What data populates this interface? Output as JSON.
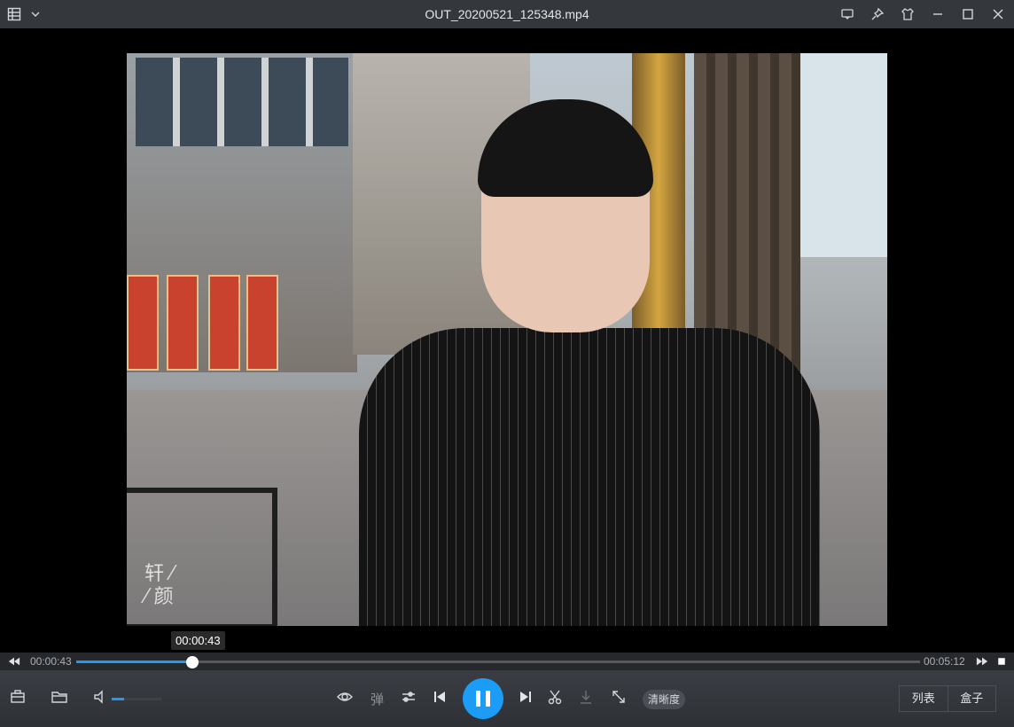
{
  "window": {
    "title": "OUT_20200521_125348.mp4",
    "left_icons": [
      "playlist-icon",
      "chevron-down-icon"
    ],
    "right_icons": [
      "message-icon",
      "pin-icon",
      "skin-icon",
      "minimize-icon",
      "maximize-icon",
      "close-icon"
    ]
  },
  "video": {
    "watermark_line1": "轩 ⁄",
    "watermark_line2": "⁄ 颜"
  },
  "playback": {
    "tooltip_time": "00:00:43",
    "current_time": "00:00:43",
    "total_time": "00:05:12",
    "progress": 0.1378,
    "volume": 0.25,
    "accent": "#1e9bf0"
  },
  "controls": {
    "danmu_label": "弹",
    "quality_label": "清晰度",
    "list_label": "列表",
    "box_label": "盒子"
  }
}
